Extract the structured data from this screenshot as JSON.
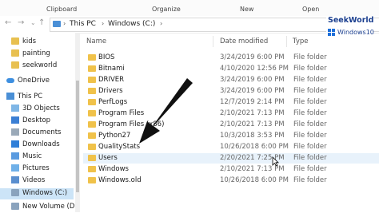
{
  "ribbon": {
    "groups": [
      "Clipboard",
      "Organize",
      "New",
      "Open"
    ]
  },
  "address": {
    "crumbs": [
      "This PC",
      "Windows (C:)"
    ]
  },
  "sidebar": {
    "items": [
      {
        "label": "kids",
        "icon": "folder-icon"
      },
      {
        "label": "painting",
        "icon": "folder-icon"
      },
      {
        "label": "seekworld",
        "icon": "folder-icon"
      },
      {
        "label": "OneDrive",
        "icon": "cloud-icon"
      },
      {
        "label": "This PC",
        "icon": "computer-icon"
      },
      {
        "label": "3D Objects",
        "icon": "cube-icon"
      },
      {
        "label": "Desktop",
        "icon": "desktop-icon"
      },
      {
        "label": "Documents",
        "icon": "documents-icon"
      },
      {
        "label": "Downloads",
        "icon": "download-icon"
      },
      {
        "label": "Music",
        "icon": "music-icon"
      },
      {
        "label": "Pictures",
        "icon": "pictures-icon"
      },
      {
        "label": "Videos",
        "icon": "videos-icon"
      },
      {
        "label": "Windows (C:)",
        "icon": "drive-icon"
      },
      {
        "label": "New Volume (D:)",
        "icon": "drive-icon"
      }
    ]
  },
  "columns": {
    "name": "Name",
    "date": "Date modified",
    "type": "Type"
  },
  "files": [
    {
      "name": "BIOS",
      "date": "3/24/2019 6:00 PM",
      "type": "File folder"
    },
    {
      "name": "Bitnami",
      "date": "4/10/2020 12:56 PM",
      "type": "File folder"
    },
    {
      "name": "DRIVER",
      "date": "3/24/2019 6:00 PM",
      "type": "File folder"
    },
    {
      "name": "Drivers",
      "date": "3/24/2019 6:00 PM",
      "type": "File folder"
    },
    {
      "name": "PerfLogs",
      "date": "12/7/2019 2:14 PM",
      "type": "File folder"
    },
    {
      "name": "Program Files",
      "date": "2/10/2021 7:13 PM",
      "type": "File folder"
    },
    {
      "name": "Program Files (x86)",
      "date": "2/10/2021 7:13 PM",
      "type": "File folder"
    },
    {
      "name": "Python27",
      "date": "10/3/2018 3:53 PM",
      "type": "File folder"
    },
    {
      "name": "QualityStats",
      "date": "10/26/2018 6:00 PM",
      "type": "File folder"
    },
    {
      "name": "Users",
      "date": "2/20/2021 7:25 PM",
      "type": "File folder"
    },
    {
      "name": "Windows",
      "date": "2/10/2021 7:13 PM",
      "type": "File folder"
    },
    {
      "name": "Windows.old",
      "date": "10/26/2018 6:00 PM",
      "type": "File folder"
    }
  ],
  "brand": {
    "name": "SeekWorld",
    "os": "Windows10"
  },
  "colors": {
    "accent": "#1e6fd9",
    "folder": "#f0c24a",
    "selected": "#cce4f7",
    "arrow": "#111111"
  }
}
